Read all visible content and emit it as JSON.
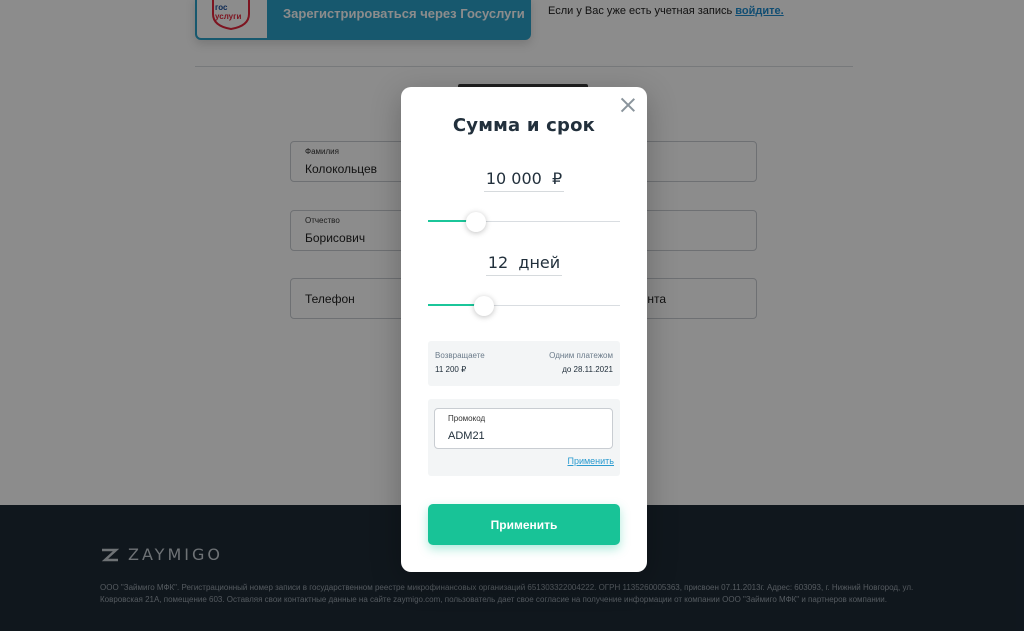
{
  "background": {
    "gosuslugi_button": {
      "logo_line1": "гос",
      "logo_line2": "услуги",
      "label": "Зарегистрироваться через Госуслуги"
    },
    "login_note": {
      "text": "Если у Вас уже есть учетная запись ",
      "link": "войдите."
    },
    "form": {
      "last_name": {
        "label": "Фамилия",
        "value": "Колокольцев"
      },
      "patronymic": {
        "label": "Отчество",
        "value": "Борисович"
      },
      "phone": {
        "placeholder": "Телефон"
      },
      "right_field_partial": "нта"
    },
    "footer": {
      "brand": "ZAYMIGO",
      "legal_text": "ООО \"Займиго МФК\". Регистрационный номер записи в государственном реестре микрофинансовых организаций 651303322004222. ОГРН 1135260005363, присвоен 07.11.2013г. Адрес: 603093, г. Нижний Новгород, ул. Ковровская 21А, помещение 603. Оставляя свои контактные данные на сайте zaymigo.com, пользователь дает свое согласие на получение информации от компании ООО \"Займиго МФК\" и партнеров компании."
    }
  },
  "modal": {
    "title": "Сумма и срок",
    "amount": {
      "value": "10 000",
      "currency": "₽",
      "slider_fraction": 0.25
    },
    "term": {
      "value": "12",
      "unit": "дней",
      "slider_fraction": 0.29
    },
    "summary": {
      "return_label": "Возвращаете",
      "return_value": "11 200 ₽",
      "payment_label": "Одним платежом",
      "payment_value": "до 28.11.2021"
    },
    "promo": {
      "label": "Промокод",
      "value": "ADM21",
      "apply_link": "Применить"
    },
    "apply_button": "Применить"
  },
  "colors": {
    "accent": "#18c397",
    "gosuslugi": "#2aa1c9",
    "footer_bg": "#1e2a36",
    "link": "#2a9bd0"
  }
}
